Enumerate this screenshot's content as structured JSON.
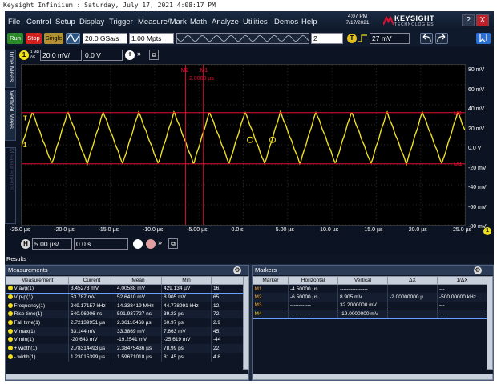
{
  "caption": "Keysight Infiniium : Saturday, July 17, 2021 4:08:17 PM",
  "menu": [
    "File",
    "Control",
    "Setup",
    "Display",
    "Trigger",
    "Measure/Mark",
    "Math",
    "Analyze",
    "Utilities",
    "Demos",
    "Help"
  ],
  "clock": {
    "time": "4:07 PM",
    "date": "7/17/2021"
  },
  "brand": {
    "name": "KEYSIGHT",
    "sub": "TECHNOLOGIES"
  },
  "window_buttons": [
    "?",
    "X"
  ],
  "toolbar": {
    "run": "Run",
    "stop": "Stop",
    "single": "Single",
    "sample_rate": "20.0 GSa/s",
    "memory_depth": "1.00 Mpts",
    "segment_count": "2",
    "trigger_badge": "T",
    "trigger_level": "27 mV"
  },
  "channel": {
    "number": "1",
    "coupling_top": "1 MΩ",
    "coupling_bottom": "AC",
    "scale": "20.0 mV/",
    "offset": "0.0 V"
  },
  "side_tabs": [
    "Time Meas",
    "Vertical Meas",
    "Measurements"
  ],
  "markers_on_plot": {
    "m2_label": "M2",
    "m1_label": "M1",
    "m_delta": "-2.0000 µs",
    "m3_label": "M3",
    "m4_label": "M4"
  },
  "plot": {
    "y_ticks": [
      "80 mV",
      "60 mV",
      "40 mV",
      "20 mV",
      "0.0 V",
      "-20 mV",
      "-40 mV",
      "-60 mV",
      "-80 mV"
    ],
    "x_ticks": [
      "-25.0 µs",
      "-20.0 µs",
      "-15.0 µs",
      "-10.0 µs",
      "-5.00 µs",
      "0.0 s",
      "5.00 µs",
      "10.0 µs",
      "15.0 µs",
      "20.0 µs",
      "25.0 µs"
    ],
    "channel_marker": "1",
    "trigger_marker": "T"
  },
  "horizontal": {
    "badge": "H",
    "scale": "5.00 µs/",
    "position": "0.0 s"
  },
  "results": {
    "title": "Results",
    "measurements": {
      "title": "Measurements",
      "columns": [
        "Measurement",
        "Current",
        "Mean",
        "Min",
        ""
      ],
      "rows": [
        [
          "V avg(1)",
          "3.45278 mV",
          "4.00588 mV",
          "429.134 µV",
          "16."
        ],
        [
          "V p-p(1)",
          "53.787 mV",
          "52.6410 mV",
          "8.905 mV",
          "65."
        ],
        [
          "Frequency(1)",
          "249.17157 kHz",
          "14.338419 MHz",
          "44.778991 kHz",
          "12."
        ],
        [
          "Rise time(1)",
          "540.06906 ns",
          "501.937727 ns",
          "39.23 ps",
          "72."
        ],
        [
          "Fall time(1)",
          "2.72139951 µs",
          "2.36110468 µs",
          "60.97 ps",
          "2.9"
        ],
        [
          "V max(1)",
          "33.144 mV",
          "33.3869 mV",
          "7.663 mV",
          "45."
        ],
        [
          "V min(1)",
          "-20.643 mV",
          "-19.2541 mV",
          "-25.619 mV",
          "-44"
        ],
        [
          "+ width(1)",
          "2.78314493 µs",
          "2.38475436 µs",
          "78.99 ps",
          "22."
        ],
        [
          "- width(1)",
          "1.23015399 µs",
          "1.59671018 µs",
          "81.45 ps",
          "4.8"
        ]
      ]
    },
    "markers": {
      "title": "Markers",
      "columns": [
        "Marker",
        "Horizontal",
        "Vertical",
        "ΔX",
        "1/ΔX"
      ],
      "rows": [
        [
          "M1",
          "-4.50000 µs",
          "----------------",
          "",
          "---"
        ],
        [
          "M2",
          "-6.50000 µs",
          "8.905 mV",
          "-2.00000000 µ",
          "-500.00000 kHz"
        ],
        [
          "M3",
          "------------",
          "32.2000000 mV",
          "",
          "---"
        ],
        [
          "M4",
          "------------",
          "-19.0000000 mV",
          "",
          "---"
        ]
      ]
    }
  },
  "colors": {
    "channel1": "#f0e020",
    "marker": "#e01030",
    "background": "#000000"
  }
}
